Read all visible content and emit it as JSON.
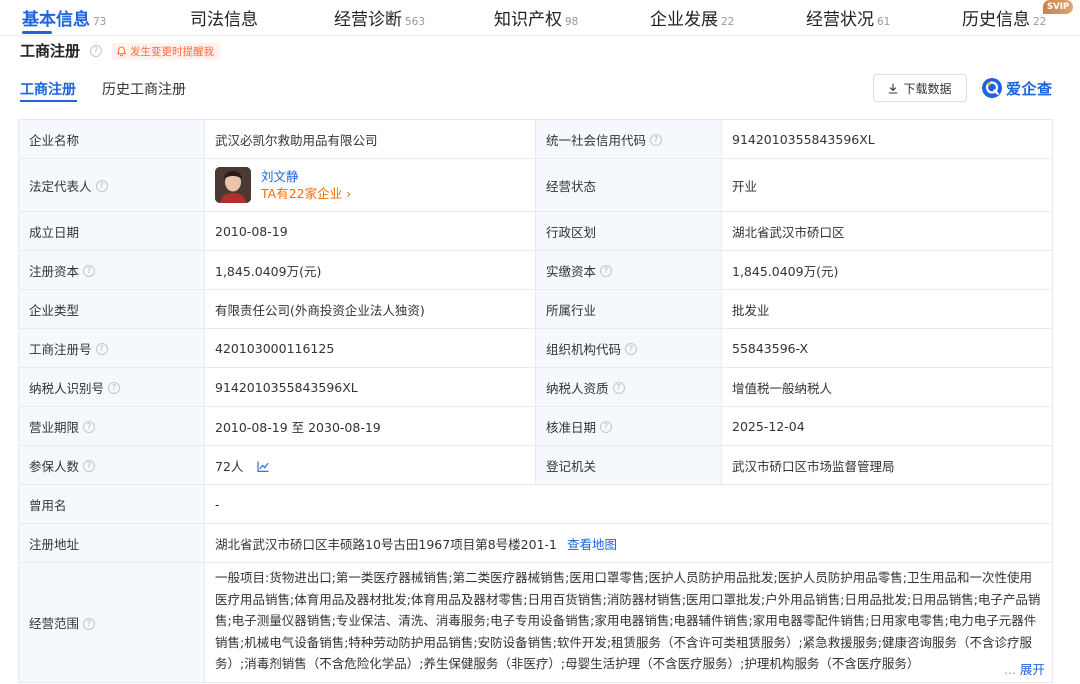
{
  "tabs": [
    {
      "label": "基本信息",
      "count": "73"
    },
    {
      "label": "司法信息",
      "count": ""
    },
    {
      "label": "经营诊断",
      "count": "563"
    },
    {
      "label": "知识产权",
      "count": "98"
    },
    {
      "label": "企业发展",
      "count": "22"
    },
    {
      "label": "经营状况",
      "count": "61"
    },
    {
      "label": "历史信息",
      "count": "22"
    }
  ],
  "svip_badge": "SVIP",
  "section": {
    "title": "工商注册",
    "help_glyph": "?",
    "change_alert": "发生变更时提醒我"
  },
  "subtabs": {
    "current": "工商注册",
    "history": "历史工商注册"
  },
  "download_label": "下载数据",
  "brand_logo_text": "爱企查",
  "info": {
    "company_name_label": "企业名称",
    "company_name": "武汉必凯尔救助用品有限公司",
    "credit_code_label": "统一社会信用代码",
    "credit_code": "914201035584359 6XL",
    "legal_rep_label": "法定代表人",
    "legal_rep_name": "刘文静",
    "legal_rep_companies": "TA有22家企业 ›",
    "status_label": "经营状态",
    "status": "开业",
    "established_label": "成立日期",
    "established": "2010-08-19",
    "region_label": "行政区划",
    "region": "湖北省武汉市硚口区",
    "reg_capital_label": "注册资本",
    "reg_capital": "1,845.0409万(元)",
    "paid_capital_label": "实缴资本",
    "paid_capital": "1,845.0409万(元)",
    "type_label": "企业类型",
    "type": "有限责任公司(外商投资企业法人独资)",
    "industry_label": "所属行业",
    "industry": "批发业",
    "reg_no_label": "工商注册号",
    "reg_no": "420103000116125",
    "org_code_label": "组织机构代码",
    "org_code": "55843596-X",
    "taxpayer_id_label": "纳税人识别号",
    "taxpayer_id": "914201035584359 6XL",
    "taxpayer_qual_label": "纳税人资质",
    "taxpayer_qual": "增值税一般纳税人",
    "term_label": "营业期限",
    "term": "2010-08-19 至 2030-08-19",
    "approved_label": "核准日期",
    "approved": "2025-12-04",
    "insured_label": "参保人数",
    "insured": "72人",
    "authority_label": "登记机关",
    "authority": "武汉市硚口区市场监督管理局",
    "former_name_label": "曾用名",
    "former_name": "-",
    "address_label": "注册地址",
    "address": "湖北省武汉市硚口区丰硕路10号古田1967项目第8号楼201-1",
    "view_map": "查看地图",
    "scope_label": "经营范围",
    "scope": "一般项目:货物进出口;第一类医疗器械销售;第二类医疗器械销售;医用口罩零售;医护人员防护用品批发;医护人员防护用品零售;卫生用品和一次性使用医疗用品销售;体育用品及器材批发;体育用品及器材零售;日用百货销售;消防器材销售;医用口罩批发;户外用品销售;日用品批发;日用品销售;电子产品销售;电子测量仪器销售;专业保洁、清洗、消毒服务;电子专用设备销售;家用电器销售;电器辅件销售;家用电器零配件销售;日用家电零售;电力电子元器件销售;机械电气设备销售;特种劳动防护用品销售;安防设备销售;软件开发;租赁服务（不含许可类租赁服务）;紧急救援服务;健康咨询服务（不含诊疗服务）;消毒剂销售（不含危险化学品）;养生保健服务（非医疗）;母婴生活护理（不含医疗服务）;护理机构服务（不含医疗服务）",
    "expand_dots": "...",
    "expand": "展开"
  }
}
